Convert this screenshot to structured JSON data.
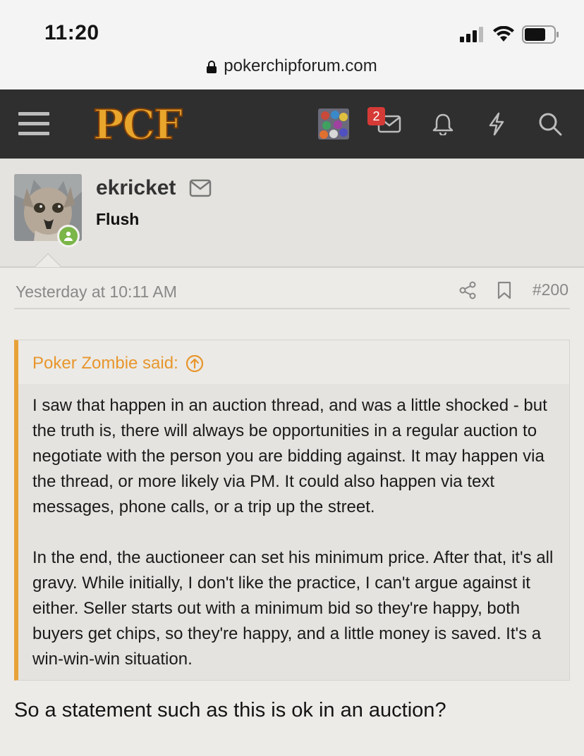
{
  "status_bar": {
    "time": "11:20",
    "url": "pokerchipforum.com"
  },
  "header": {
    "logo_text": "PCF",
    "conversations_badge": "2",
    "icons": [
      "menu-icon",
      "avatar-icon",
      "mail-icon",
      "bell-icon",
      "bolt-icon",
      "search-icon"
    ]
  },
  "member": {
    "username": "ekricket",
    "title": "Flush",
    "online": true
  },
  "post": {
    "date": "Yesterday at 10:11 AM",
    "number": "#200",
    "quote": {
      "author_line": "Poker Zombie said:",
      "paragraphs": [
        "I saw that happen in an auction thread, and was a little shocked - but the truth is, there will always be opportunities in a regular auction to negotiate with the person you are bidding against. It may happen via the thread, or more likely via PM. It could also happen via text messages, phone calls, or a trip up the street.",
        "In the end, the auctioneer can set his minimum price. After that, it's all gravy. While initially, I don't like the practice, I can't argue against it either. Seller starts out with a minimum bid so they're happy, both buyers get chips, so they're happy, and a little money is saved. It's a win-win-win situation."
      ]
    },
    "reply": "So a statement such as this is ok in an auction?"
  },
  "colors": {
    "accent": "#e8a23a",
    "header_bg": "#2f2f2f",
    "badge": "#d63a37",
    "online": "#7ab648"
  }
}
